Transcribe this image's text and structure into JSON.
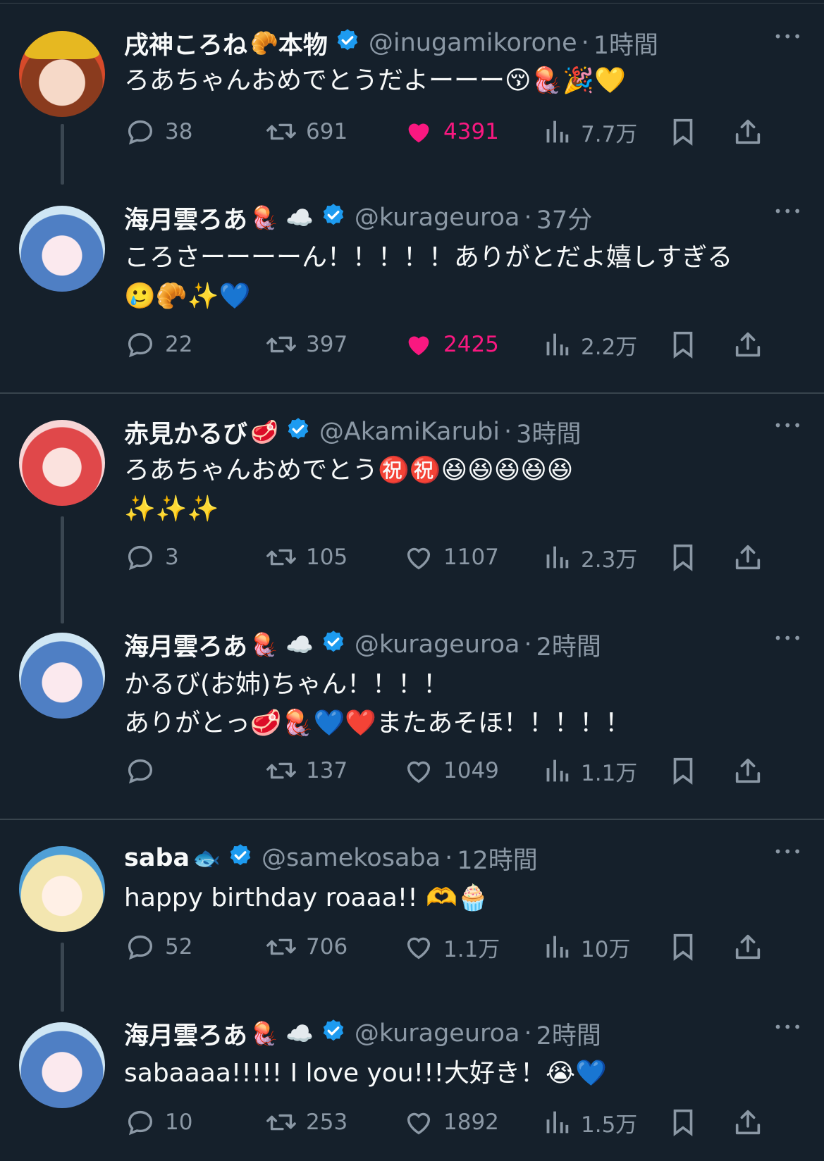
{
  "colors": {
    "background": "#15202b",
    "like_active": "#f91880",
    "verified": "#1d9bf0",
    "muted": "#8b98a5"
  },
  "tweets": [
    {
      "name": "戌神ころね",
      "name_emoji": "🥐",
      "name_suffix": "本物",
      "handle": "@inugamikorone",
      "dot": "·",
      "time": "1時間",
      "text": "ろあちゃんおめでとうだよーーー😚🪼🎉💛",
      "replies": "38",
      "retweets": "691",
      "likes": "4391",
      "views": "7.7万",
      "liked": true
    },
    {
      "name": "海月雲ろあ",
      "name_emoji": "🪼 ☁️",
      "name_suffix": "",
      "handle": "@kurageuroa",
      "dot": "·",
      "time": "37分",
      "text": "ころさーーーーん！！！！！ありがとだよ嬉しすぎる\n🥲🥐✨💙",
      "replies": "22",
      "retweets": "397",
      "likes": "2425",
      "views": "2.2万",
      "liked": true
    },
    {
      "name": "赤見かるび",
      "name_emoji": "🥩",
      "name_suffix": "",
      "handle": "@AkamiKarubi",
      "dot": "·",
      "time": "3時間",
      "text": "ろあちゃんおめでとう㊗️㊗️😆😆😆😆😆\n✨✨✨",
      "replies": "3",
      "retweets": "105",
      "likes": "1107",
      "views": "2.3万",
      "liked": false
    },
    {
      "name": "海月雲ろあ",
      "name_emoji": "🪼 ☁️",
      "name_suffix": "",
      "handle": "@kurageuroa",
      "dot": "·",
      "time": "2時間",
      "text": "かるび(お姉)ちゃん！！！！\nありがとっ🥩🪼💙❤️またあそほ！！！！！",
      "replies": "",
      "retweets": "137",
      "likes": "1049",
      "views": "1.1万",
      "liked": false
    },
    {
      "name": "saba",
      "name_emoji": "🐟",
      "name_suffix": "",
      "handle": "@samekosaba",
      "dot": "·",
      "time": "12時間",
      "text": "happy birthday roaaa!! 🫶🧁",
      "replies": "52",
      "retweets": "706",
      "likes": "1.1万",
      "views": "10万",
      "liked": false
    },
    {
      "name": "海月雲ろあ",
      "name_emoji": "🪼 ☁️",
      "name_suffix": "",
      "handle": "@kurageuroa",
      "dot": "·",
      "time": "2時間",
      "text": "sabaaaa!!!!! I love you!!!大好き！😭💙",
      "replies": "10",
      "retweets": "253",
      "likes": "1892",
      "views": "1.5万",
      "liked": false
    }
  ]
}
